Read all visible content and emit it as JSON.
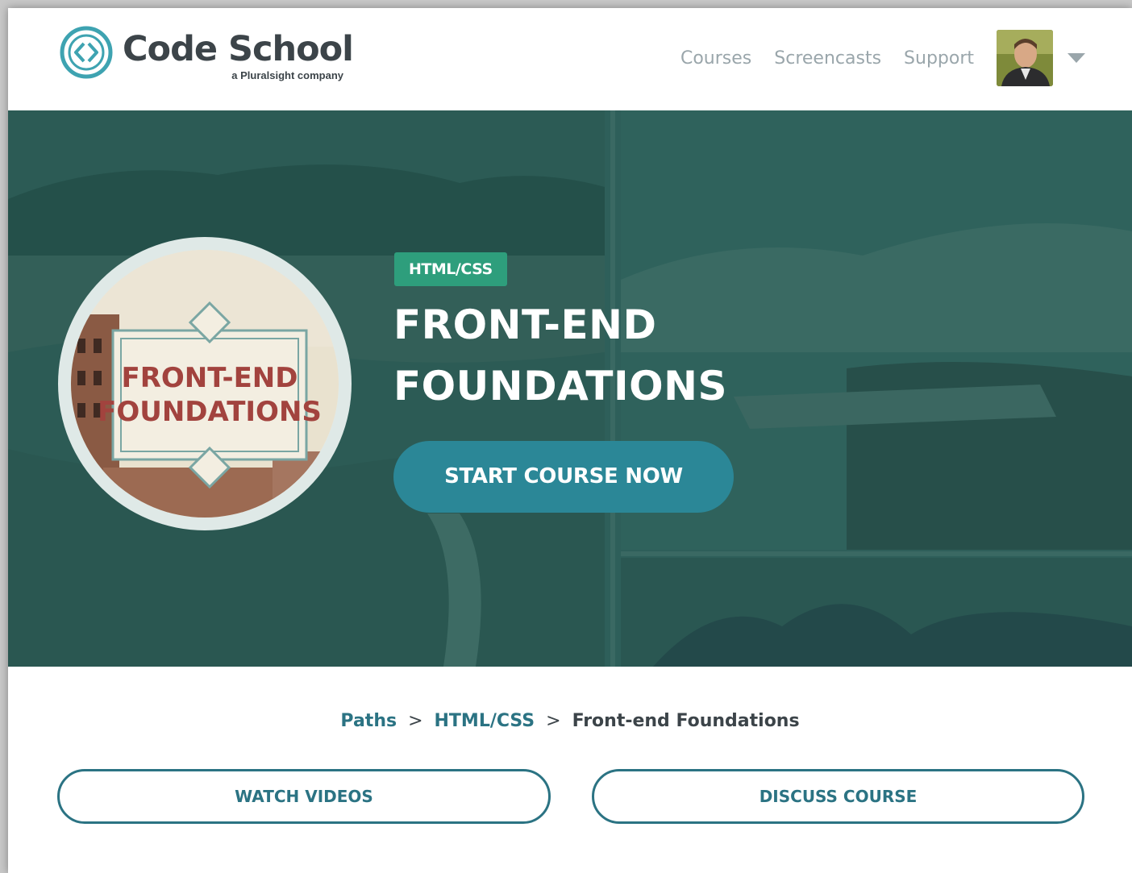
{
  "header": {
    "brand": "Code School",
    "brand_sub": "a Pluralsight company",
    "nav": [
      "Courses",
      "Screencasts",
      "Support"
    ]
  },
  "hero": {
    "tag": "HTML/CSS",
    "title_line1": "FRONT-END",
    "title_line2": "FOUNDATIONS",
    "badge_line1": "FRONT-END",
    "badge_line2": "FOUNDATIONS",
    "cta": "START COURSE NOW"
  },
  "breadcrumb": {
    "items": [
      "Paths",
      "HTML/CSS",
      "Front-end Foundations"
    ],
    "separator": ">"
  },
  "actions": {
    "watch": "WATCH VIDEOS",
    "discuss": "DISCUSS COURSE"
  },
  "colors": {
    "accent": "#2b7383",
    "hero_bg": "#2d5e59",
    "tag_bg": "#2e9e7c",
    "cta_bg": "#2b8797"
  }
}
